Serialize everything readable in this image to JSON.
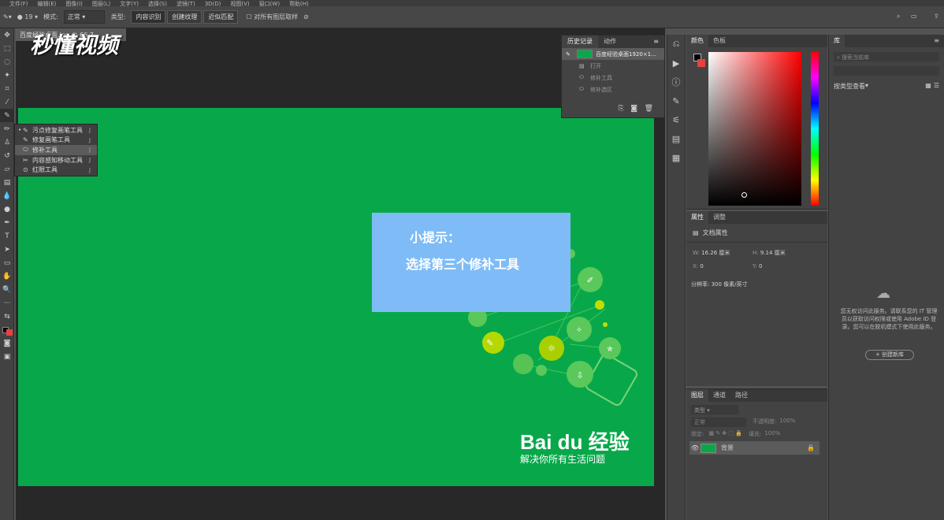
{
  "menu": [
    "文件(F)",
    "编辑(E)",
    "图像(I)",
    "图层(L)",
    "文字(Y)",
    "选择(S)",
    "滤镜(T)",
    "3D(D)",
    "视图(V)",
    "窗口(W)",
    "帮助(H)"
  ],
  "options": {
    "brush_size": "19",
    "mode_label": "模式:",
    "mode_value": "正常",
    "type_label": "类型:",
    "type_buttons": [
      "内容识别",
      "创建纹理",
      "近似匹配"
    ],
    "sample_all": "对所有图层取样"
  },
  "document": {
    "tab_title": "百度经验桌面.jpg @ 66.7",
    "watermark": "秒懂视频"
  },
  "flyout": {
    "items": [
      {
        "label": "污点修复画笔工具",
        "key": "J",
        "icon": "spot-heal-icon"
      },
      {
        "label": "修复画笔工具",
        "key": "J",
        "icon": "healing-brush-icon"
      },
      {
        "label": "修补工具",
        "key": "J",
        "icon": "patch-icon"
      },
      {
        "label": "内容感知移动工具",
        "key": "J",
        "icon": "content-move-icon"
      },
      {
        "label": "红眼工具",
        "key": "J",
        "icon": "red-eye-icon"
      }
    ]
  },
  "tip": {
    "line1": "小提示：",
    "line2": "选择第三个修补工具"
  },
  "baidu": {
    "logo": "Bai du 经验",
    "slogan": "解决你所有生活问题"
  },
  "history": {
    "tabs": [
      "历史记录",
      "动作"
    ],
    "snapshot": "百度经验桌面1920×1...",
    "steps": [
      "打开",
      "修补工具",
      "修补选区"
    ]
  },
  "color": {
    "tabs": [
      "颜色",
      "色板"
    ]
  },
  "properties": {
    "tabs": [
      "属性",
      "调整"
    ],
    "doc_label": "文档属性",
    "w_label": "W:",
    "w_value": "16.26 厘米",
    "h_label": "H:",
    "h_value": "9.14 厘米",
    "x_label": "X:",
    "x_value": "0",
    "y_label": "Y:",
    "y_value": "0",
    "resolution": "分辨率: 300 像素/英寸"
  },
  "layers": {
    "tabs": [
      "图层",
      "通道",
      "路径"
    ],
    "filter_placeholder": "类型",
    "blend": "正常",
    "opacity_label": "不透明度:",
    "opacity_value": "100%",
    "lock_label": "锁定:",
    "fill_label": "填充:",
    "fill_value": "100%",
    "layer_name": "背景"
  },
  "library": {
    "tab": "库",
    "search_placeholder": "搜索当前库",
    "view_label": "按类型查看",
    "message": "您无权访问此服务。请联系您的 IT 管理员以获取访问权限或使用 Adobe ID 登录。您可以在脱机模式下使用此服务。",
    "create_button": "+ 创建新库"
  },
  "colors": {
    "canvas": "#08a84a",
    "tip_bg": "#7fbcf7"
  }
}
